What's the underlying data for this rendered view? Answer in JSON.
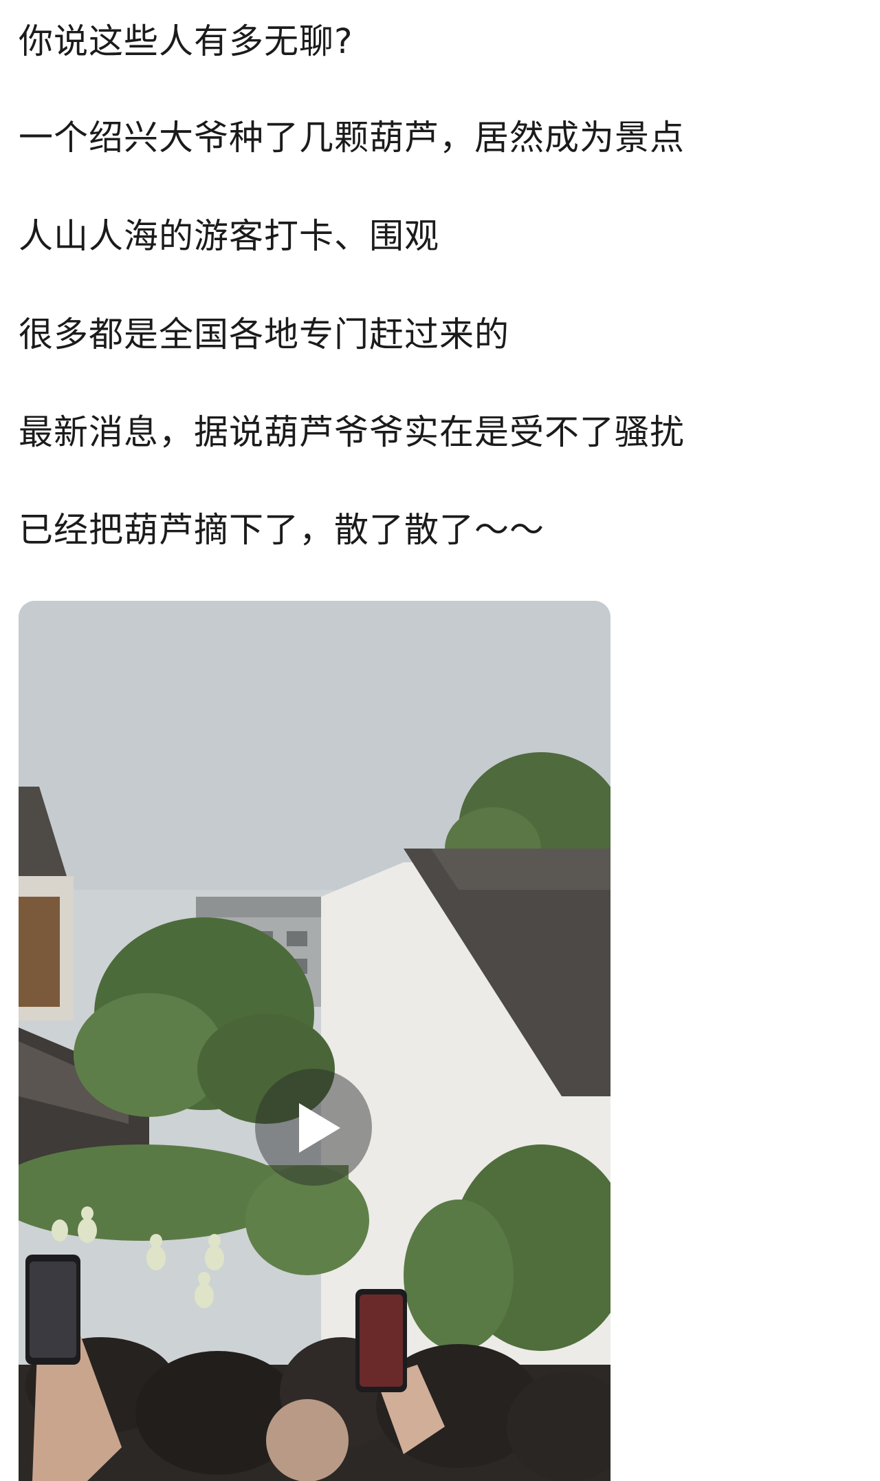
{
  "post": {
    "lines": [
      "你说这些人有多无聊?",
      "一个绍兴大爷种了几颗葫芦，居然成为景点",
      "人山人海的游客打卡、围观",
      "很多都是全国各地专门赶过来的",
      "最新消息，据说葫芦爷爷实在是受不了骚扰",
      "已经把葫芦摘下了，散了散了～～"
    ]
  },
  "video": {
    "play_icon": "play-icon",
    "colors": {
      "sky": "#c9ced1",
      "wall": "#e9e9e6",
      "roof": "#4d4a47",
      "foliage": "#5a7a45",
      "crowd": "#2a2624"
    }
  }
}
